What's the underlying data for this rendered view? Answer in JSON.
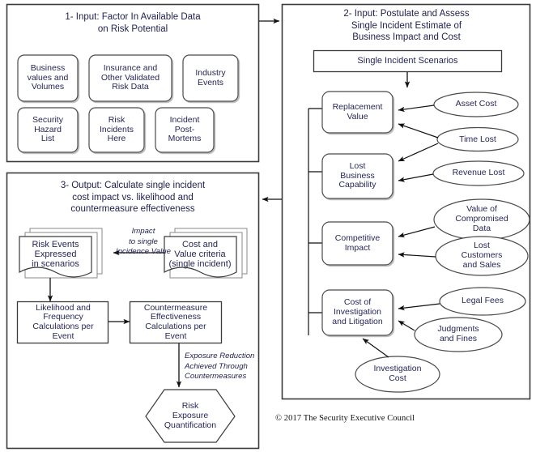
{
  "figure": {
    "copyright": "© 2017 The Security Executive Council"
  },
  "panel1": {
    "title": "1- Input: Factor In Available Data\non Risk Potential",
    "title_line1": "1- Input: Factor In Available Data",
    "title_line2": "on Risk Potential",
    "boxes": [
      {
        "label": "Business\nvalues and\nVolumes"
      },
      {
        "label": "Insurance and\nOther Validated\nRisk Data"
      },
      {
        "label": "Industry\nEvents"
      },
      {
        "label": "Security\nHazard\nList"
      },
      {
        "label": "Risk\nIncidents\nHere"
      },
      {
        "label": "Incident\nPost-\nMortems"
      }
    ]
  },
  "panel2": {
    "title_line1": "2- Input: Postulate and Assess",
    "title_line2": "Single Incident Estimate of",
    "title_line3": "Business Impact and Cost",
    "header_box": "Single Incident Scenarios",
    "categories": [
      {
        "label": "Replacement\nValue"
      },
      {
        "label": "Lost\nBusiness\nCapability"
      },
      {
        "label": "Competitive\nImpact"
      },
      {
        "label": "Cost of\nInvestigation\nand Litigation"
      }
    ],
    "drivers": [
      {
        "label": "Asset Cost"
      },
      {
        "label": "Time Lost"
      },
      {
        "label": "Revenue Lost"
      },
      {
        "label": "Value of\nCompromised\nData"
      },
      {
        "label": "Lost\nCustomers\nand Sales"
      },
      {
        "label": "Legal Fees"
      },
      {
        "label": "Judgments\nand Fines"
      },
      {
        "label": "Investigation\nCost"
      }
    ]
  },
  "panel3": {
    "title_line1": "3- Output: Calculate single incident",
    "title_line2": "cost impact vs. likelihood and",
    "title_line3": "countermeasure effectiveness",
    "documents": [
      {
        "label": "Risk Events\nExpressed\nin scenarios"
      },
      {
        "label": "Cost and\nValue criteria\n(single incident)"
      }
    ],
    "arrow_label_1": "Impact\nto single\nIncidence Value",
    "arrow_label_1_lines": [
      "Impact",
      "to single",
      "Incidence Value"
    ],
    "process_boxes": [
      {
        "label": "Likelihood and\nFrequency\nCalculations per\nEvent"
      },
      {
        "label": "Countermeasure\nEffectiveness\nCalculations per\nEvent"
      }
    ],
    "arrow_label_2_lines": [
      "Exposure Reduction",
      "Achieved Through",
      "Countermeasures"
    ],
    "hexagon": {
      "label": "Risk\nExposure\nQuantification"
    }
  },
  "colors": {
    "border": "#3a3a3a",
    "shadow": "#b9b9b9",
    "text": "#262657",
    "background": "#ffffff"
  }
}
